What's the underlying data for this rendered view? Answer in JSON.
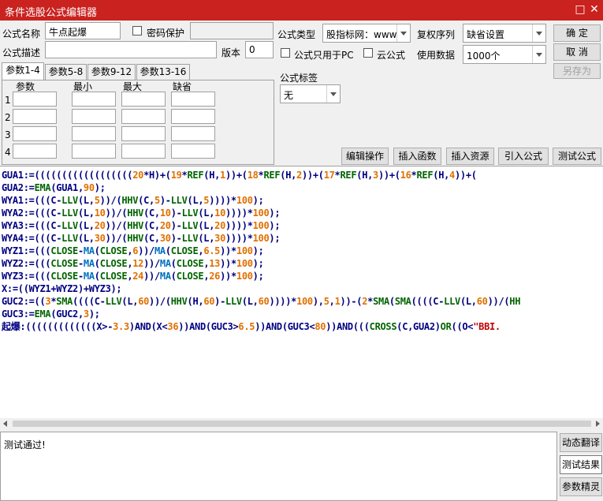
{
  "window": {
    "title": "条件选股公式编辑器",
    "restore_glyph": "□",
    "close_glyph": "✕"
  },
  "form": {
    "name_label": "公式名称",
    "name_value": "牛点起爆",
    "password_label": "密码保护",
    "desc_label": "公式描述",
    "desc_value": "",
    "version_label": "版本",
    "version_value": "0",
    "type_label": "公式类型",
    "type_value": "股指标网：www",
    "pc_only_label": "公式只用于PC",
    "cloud_label": "云公式",
    "adjust_label": "复权序列",
    "adjust_value": "缺省设置",
    "data_label": "使用数据",
    "data_value": "1000个",
    "tag_label": "公式标签",
    "tag_value": "无"
  },
  "buttons": {
    "ok": "确  定",
    "cancel": "取  消",
    "save_as": "另存为",
    "edit_ops": "编辑操作",
    "insert_func": "插入函数",
    "insert_res": "插入资源",
    "import": "引入公式",
    "test": "测试公式"
  },
  "tabs": [
    "参数1-4",
    "参数5-8",
    "参数9-12",
    "参数13-16"
  ],
  "params": {
    "headers": [
      "参数",
      "最小",
      "最大",
      "缺省"
    ],
    "rows": [
      "1",
      "2",
      "3",
      "4"
    ]
  },
  "code_lines": [
    [
      [
        "GUA1:=((((((((((((((((((",
        "k"
      ],
      [
        "20",
        "n"
      ],
      [
        "*H)+(",
        "k"
      ],
      [
        "19",
        "n"
      ],
      [
        "*",
        "k"
      ],
      [
        "REF",
        "f"
      ],
      [
        "(H,",
        "k"
      ],
      [
        "1",
        "n"
      ],
      [
        "))+(",
        "k"
      ],
      [
        "18",
        "n"
      ],
      [
        "*",
        "k"
      ],
      [
        "REF",
        "f"
      ],
      [
        "(H,",
        "k"
      ],
      [
        "2",
        "n"
      ],
      [
        "))+(",
        "k"
      ],
      [
        "17",
        "n"
      ],
      [
        "*",
        "k"
      ],
      [
        "REF",
        "f"
      ],
      [
        "(H,",
        "k"
      ],
      [
        "3",
        "n"
      ],
      [
        "))+(",
        "k"
      ],
      [
        "16",
        "n"
      ],
      [
        "*",
        "k"
      ],
      [
        "REF",
        "f"
      ],
      [
        "(H,",
        "k"
      ],
      [
        "4",
        "n"
      ],
      [
        "))+(",
        "k"
      ]
    ],
    [
      [
        "GUA2:=",
        "k"
      ],
      [
        "EMA",
        "f"
      ],
      [
        "(GUA1,",
        "k"
      ],
      [
        "90",
        "n"
      ],
      [
        ");",
        "k"
      ]
    ],
    [
      [
        "WYA1:=(((C-",
        "k"
      ],
      [
        "LLV",
        "f"
      ],
      [
        "(L,",
        "k"
      ],
      [
        "5",
        "n"
      ],
      [
        "))/(",
        "k"
      ],
      [
        "HHV",
        "f"
      ],
      [
        "(C,",
        "k"
      ],
      [
        "5",
        "n"
      ],
      [
        ")-",
        "k"
      ],
      [
        "LLV",
        "f"
      ],
      [
        "(L,",
        "k"
      ],
      [
        "5",
        "n"
      ],
      [
        "))))*",
        "k"
      ],
      [
        "100",
        "n"
      ],
      [
        ");",
        "k"
      ]
    ],
    [
      [
        "WYA2:=(((C-",
        "k"
      ],
      [
        "LLV",
        "f"
      ],
      [
        "(L,",
        "k"
      ],
      [
        "10",
        "n"
      ],
      [
        "))/(",
        "k"
      ],
      [
        "HHV",
        "f"
      ],
      [
        "(C,",
        "k"
      ],
      [
        "10",
        "n"
      ],
      [
        ")-",
        "k"
      ],
      [
        "LLV",
        "f"
      ],
      [
        "(L,",
        "k"
      ],
      [
        "10",
        "n"
      ],
      [
        "))))*",
        "k"
      ],
      [
        "100",
        "n"
      ],
      [
        ");",
        "k"
      ]
    ],
    [
      [
        "WYA3:=(((C-",
        "k"
      ],
      [
        "LLV",
        "f"
      ],
      [
        "(L,",
        "k"
      ],
      [
        "20",
        "n"
      ],
      [
        "))/(",
        "k"
      ],
      [
        "HHV",
        "f"
      ],
      [
        "(C,",
        "k"
      ],
      [
        "20",
        "n"
      ],
      [
        ")-",
        "k"
      ],
      [
        "LLV",
        "f"
      ],
      [
        "(L,",
        "k"
      ],
      [
        "20",
        "n"
      ],
      [
        "))))*",
        "k"
      ],
      [
        "100",
        "n"
      ],
      [
        ");",
        "k"
      ]
    ],
    [
      [
        "WYA4:=(((C-",
        "k"
      ],
      [
        "LLV",
        "f"
      ],
      [
        "(L,",
        "k"
      ],
      [
        "30",
        "n"
      ],
      [
        "))/(",
        "k"
      ],
      [
        "HHV",
        "f"
      ],
      [
        "(C,",
        "k"
      ],
      [
        "30",
        "n"
      ],
      [
        ")-",
        "k"
      ],
      [
        "LLV",
        "f"
      ],
      [
        "(L,",
        "k"
      ],
      [
        "30",
        "n"
      ],
      [
        "))))*",
        "k"
      ],
      [
        "100",
        "n"
      ],
      [
        ");",
        "k"
      ]
    ],
    [
      [
        "WYZ1:=(((",
        "k"
      ],
      [
        "CLOSE",
        "f"
      ],
      [
        "-",
        "k"
      ],
      [
        "MA",
        "m"
      ],
      [
        "(",
        "k"
      ],
      [
        "CLOSE",
        "f"
      ],
      [
        ",",
        "k"
      ],
      [
        "6",
        "n"
      ],
      [
        "))/",
        "k"
      ],
      [
        "MA",
        "m"
      ],
      [
        "(",
        "k"
      ],
      [
        "CLOSE",
        "f"
      ],
      [
        ",",
        "k"
      ],
      [
        "6.5",
        "n"
      ],
      [
        "))*",
        "k"
      ],
      [
        "100",
        "n"
      ],
      [
        ");",
        "k"
      ]
    ],
    [
      [
        "WYZ2:=(((",
        "k"
      ],
      [
        "CLOSE",
        "f"
      ],
      [
        "-",
        "k"
      ],
      [
        "MA",
        "m"
      ],
      [
        "(",
        "k"
      ],
      [
        "CLOSE",
        "f"
      ],
      [
        ",",
        "k"
      ],
      [
        "12",
        "n"
      ],
      [
        "))/",
        "k"
      ],
      [
        "MA",
        "m"
      ],
      [
        "(",
        "k"
      ],
      [
        "CLOSE",
        "f"
      ],
      [
        ",",
        "k"
      ],
      [
        "13",
        "n"
      ],
      [
        "))*",
        "k"
      ],
      [
        "100",
        "n"
      ],
      [
        ");",
        "k"
      ]
    ],
    [
      [
        "WYZ3:=(((",
        "k"
      ],
      [
        "CLOSE",
        "f"
      ],
      [
        "-",
        "k"
      ],
      [
        "MA",
        "m"
      ],
      [
        "(",
        "k"
      ],
      [
        "CLOSE",
        "f"
      ],
      [
        ",",
        "k"
      ],
      [
        "24",
        "n"
      ],
      [
        "))/",
        "k"
      ],
      [
        "MA",
        "m"
      ],
      [
        "(",
        "k"
      ],
      [
        "CLOSE",
        "f"
      ],
      [
        ",",
        "k"
      ],
      [
        "26",
        "n"
      ],
      [
        "))*",
        "k"
      ],
      [
        "100",
        "n"
      ],
      [
        ");",
        "k"
      ]
    ],
    [
      [
        "X:=((WYZ1+WYZ2)+WYZ3);",
        "k"
      ]
    ],
    [
      [
        "GUC2:=((",
        "k"
      ],
      [
        "3",
        "n"
      ],
      [
        "*",
        "k"
      ],
      [
        "SMA",
        "f"
      ],
      [
        "((((C-",
        "k"
      ],
      [
        "LLV",
        "f"
      ],
      [
        "(L,",
        "k"
      ],
      [
        "60",
        "n"
      ],
      [
        "))/(",
        "k"
      ],
      [
        "HHV",
        "f"
      ],
      [
        "(H,",
        "k"
      ],
      [
        "60",
        "n"
      ],
      [
        ")-",
        "k"
      ],
      [
        "LLV",
        "f"
      ],
      [
        "(L,",
        "k"
      ],
      [
        "60",
        "n"
      ],
      [
        "))))*",
        "k"
      ],
      [
        "100",
        "n"
      ],
      [
        "),",
        "k"
      ],
      [
        "5",
        "n"
      ],
      [
        ",",
        "k"
      ],
      [
        "1",
        "n"
      ],
      [
        "))-(",
        "k"
      ],
      [
        "2",
        "n"
      ],
      [
        "*",
        "k"
      ],
      [
        "SMA",
        "f"
      ],
      [
        "(",
        "k"
      ],
      [
        "SMA",
        "f"
      ],
      [
        "((((C-",
        "k"
      ],
      [
        "LLV",
        "f"
      ],
      [
        "(L,",
        "k"
      ],
      [
        "60",
        "n"
      ],
      [
        "))/(",
        "k"
      ],
      [
        "HH",
        "f"
      ]
    ],
    [
      [
        "GUC3:=",
        "k"
      ],
      [
        "EMA",
        "f"
      ],
      [
        "(GUC2,",
        "k"
      ],
      [
        "3",
        "n"
      ],
      [
        ");",
        "k"
      ]
    ],
    [
      [
        "起爆",
        "k"
      ],
      [
        ":(((((((((((((X>-",
        "k"
      ],
      [
        "3.3",
        "n"
      ],
      [
        ")AND(X<",
        "k"
      ],
      [
        "36",
        "n"
      ],
      [
        "))AND(GUC3>",
        "k"
      ],
      [
        "6.5",
        "n"
      ],
      [
        "))AND(GUC3<",
        "k"
      ],
      [
        "80",
        "n"
      ],
      [
        "))AND(((",
        "k"
      ],
      [
        "CROSS",
        "f"
      ],
      [
        "(C,GUA2)",
        "k"
      ],
      [
        "OR",
        "f"
      ],
      [
        "((O<",
        "k"
      ],
      [
        "\"BBI.",
        "s"
      ]
    ]
  ],
  "output": {
    "text": "测试通过!"
  },
  "side_buttons": [
    "动态翻译",
    "测试结果",
    "参数精灵"
  ]
}
